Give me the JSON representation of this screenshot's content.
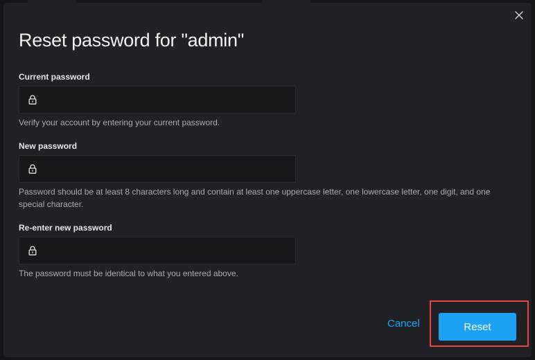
{
  "dialog": {
    "title": "Reset password for \"admin\"",
    "close_icon": "close-icon"
  },
  "fields": [
    {
      "label": "Current password",
      "value": "",
      "icon": "lock-icon",
      "help": "Verify your account by entering your current password."
    },
    {
      "label": "New password",
      "value": "",
      "icon": "lock-icon",
      "help": "Password should be at least 8 characters long and contain at least one uppercase letter, one lowercase letter, one digit, and one special character."
    },
    {
      "label": "Re-enter new password",
      "value": "",
      "icon": "lock-icon",
      "help": "The password must be identical to what you entered above."
    }
  ],
  "actions": {
    "cancel_label": "Cancel",
    "reset_label": "Reset"
  },
  "colors": {
    "accent": "#1da1f2",
    "highlight": "#e5463f",
    "surface": "#212227",
    "input_bg": "#17181c"
  }
}
